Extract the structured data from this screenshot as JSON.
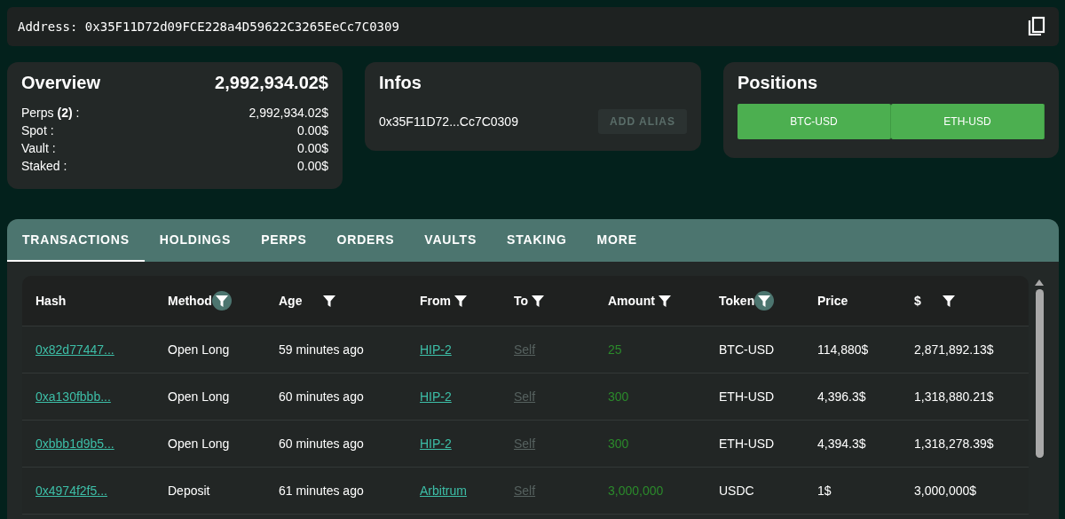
{
  "address_bar": {
    "label": "Address:",
    "address": "0x35F11D72d09FCE228a4D59622C3265EeCc7C0309"
  },
  "overview": {
    "title": "Overview",
    "total": "2,992,934.02$",
    "items": [
      {
        "label": "Perps **(2)** :",
        "value": "2,992,934.02$"
      },
      {
        "label": "Spot :",
        "value": "0.00$"
      },
      {
        "label": "Vault :",
        "value": "0.00$"
      },
      {
        "label": "Staked :",
        "value": "0.00$"
      }
    ]
  },
  "infos": {
    "title": "Infos",
    "short_address": "0x35F11D72...Cc7C0309",
    "button": {
      "label": "ADD ALIAS",
      "disabled": true
    }
  },
  "positions": {
    "title": "Positions",
    "items": [
      "BTC-USD",
      "ETH-USD"
    ]
  },
  "tabs": [
    {
      "label": "TRANSACTIONS",
      "selected": true
    },
    {
      "label": "HOLDINGS",
      "selected": false
    },
    {
      "label": "PERPS",
      "selected": false
    },
    {
      "label": "ORDERS",
      "selected": false
    },
    {
      "label": "VAULTS",
      "selected": false
    },
    {
      "label": "STAKING",
      "selected": false
    },
    {
      "label": "MORE",
      "selected": false
    }
  ],
  "table": {
    "columns": [
      {
        "label": "Hash",
        "filter": false,
        "filter_active": false
      },
      {
        "label": "Method",
        "filter": true,
        "filter_active": true
      },
      {
        "label": "Age",
        "filter": true,
        "filter_active": false
      },
      {
        "label": "From",
        "filter": true,
        "filter_active": false
      },
      {
        "label": "To",
        "filter": true,
        "filter_active": false
      },
      {
        "label": "Amount",
        "filter": true,
        "filter_active": false
      },
      {
        "label": "Token",
        "filter": true,
        "filter_active": true
      },
      {
        "label": "Price",
        "filter": false,
        "filter_active": false
      },
      {
        "label": "$",
        "filter": true,
        "filter_active": false
      }
    ],
    "rows": [
      {
        "hash": "0x82d77447...",
        "method": "Open Long",
        "age": "59 minutes ago",
        "from": "HIP-2",
        "to": "Self",
        "amount": "25",
        "token": "BTC-USD",
        "price": "114,880$",
        "usd": "2,871,892.13$"
      },
      {
        "hash": "0xa130fbbb...",
        "method": "Open Long",
        "age": "60 minutes ago",
        "from": "HIP-2",
        "to": "Self",
        "amount": "300",
        "token": "ETH-USD",
        "price": "4,396.3$",
        "usd": "1,318,880.21$"
      },
      {
        "hash": "0xbbb1d9b5...",
        "method": "Open Long",
        "age": "60 minutes ago",
        "from": "HIP-2",
        "to": "Self",
        "amount": "300",
        "token": "ETH-USD",
        "price": "4,394.3$",
        "usd": "1,318,278.39$"
      },
      {
        "hash": "0x4974f2f5...",
        "method": "Deposit",
        "age": "61 minutes ago",
        "from": "Arbitrum",
        "to": "Self",
        "amount": "3,000,000",
        "token": "USDC",
        "price": "1$",
        "usd": "3,000,000$"
      }
    ]
  }
}
